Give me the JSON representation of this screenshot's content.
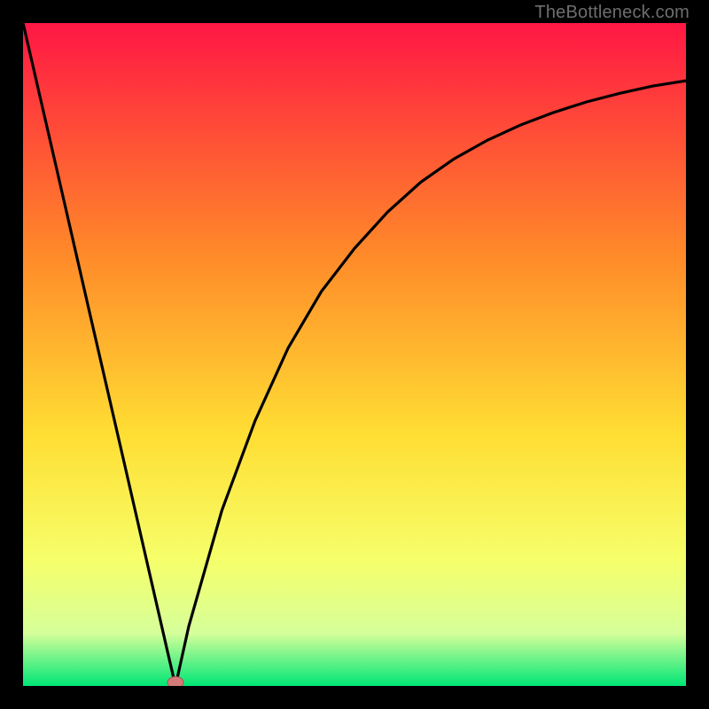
{
  "attribution": "TheBottleneck.com",
  "colors": {
    "top": "#ff1744",
    "mid_upper": "#ff8a29",
    "mid": "#ffde33",
    "lower": "#f6ff6a",
    "band": "#d6ff9a",
    "bottom": "#00e676",
    "frame": "#000000",
    "curve": "#000000",
    "marker_fill": "#d37b78",
    "marker_stroke": "#a35654"
  },
  "chart_data": {
    "type": "line",
    "title": "",
    "xlabel": "",
    "ylabel": "",
    "xlim": [
      0,
      100
    ],
    "ylim": [
      0,
      100
    ],
    "series": [
      {
        "name": "bottleneck-curve",
        "x": [
          0,
          5,
          10,
          15,
          20,
          22,
          23,
          24,
          25,
          30,
          35,
          40,
          45,
          50,
          55,
          60,
          65,
          70,
          75,
          80,
          85,
          90,
          95,
          100
        ],
        "values": [
          100,
          78.3,
          56.5,
          34.8,
          13.0,
          4.3,
          0.0,
          4.5,
          9.0,
          26.5,
          40.0,
          51.0,
          59.5,
          66.0,
          71.5,
          76.0,
          79.5,
          82.3,
          84.6,
          86.5,
          88.1,
          89.4,
          90.5,
          91.3
        ]
      }
    ],
    "marker": {
      "x": 23,
      "y": 0
    },
    "gradient_stops": [
      {
        "offset": 0.0,
        "color": "#ff1744"
      },
      {
        "offset": 0.35,
        "color": "#ff8a29"
      },
      {
        "offset": 0.62,
        "color": "#ffde33"
      },
      {
        "offset": 0.81,
        "color": "#f6ff6a"
      },
      {
        "offset": 0.92,
        "color": "#d6ff9a"
      },
      {
        "offset": 1.0,
        "color": "#00e676"
      }
    ]
  }
}
